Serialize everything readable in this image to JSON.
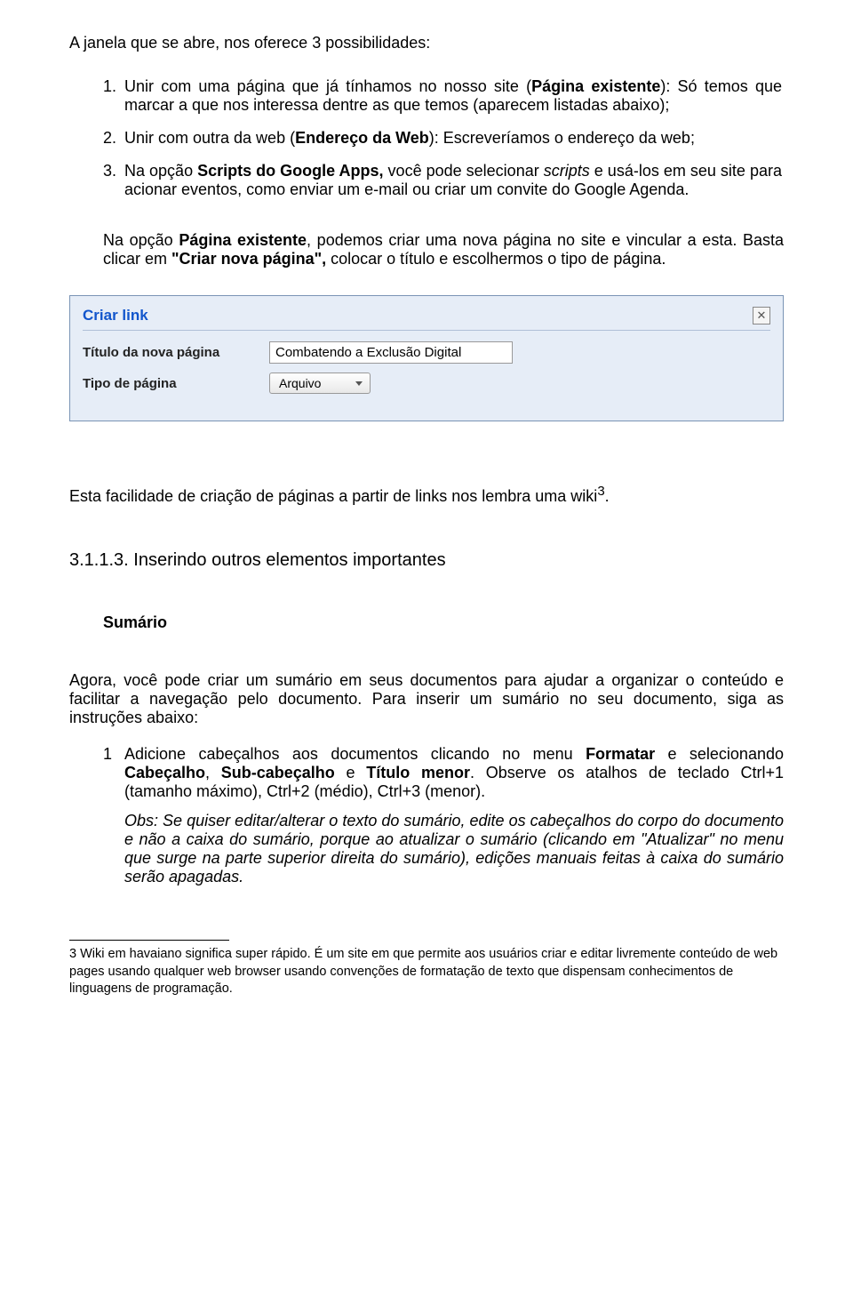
{
  "intro": "A janela que se abre, nos oferece 3 possibilidades:",
  "list": [
    {
      "num": "1.",
      "prefix": "Unir com uma página que já tínhamos no nosso site (",
      "bold1": "Página existente",
      "rest": "): Só temos que marcar a que nos interessa dentre as que temos (aparecem listadas abaixo);"
    },
    {
      "num": "2.",
      "prefix": "Unir com outra da web (",
      "bold1": "Endereço da Web",
      "rest": "): Escreveríamos o endereço da web;"
    },
    {
      "num": "3.",
      "prefix": "Na opção ",
      "bold1": "Scripts do Google Apps,",
      "rest2a": " você pode selecionar ",
      "italic1": "scripts",
      "rest2b": " e usá-los em seu site para acionar eventos, como enviar um e-mail ou criar um convite do Google Agenda."
    }
  ],
  "indented": {
    "p1a": "Na opção ",
    "p1b": "Página existente",
    "p1c": ", podemos criar uma nova página no site e vincular a esta. Basta clicar em ",
    "p1d": "\"Criar nova página\",",
    "p1e": " colocar o título e escolhermos o tipo de página."
  },
  "dialog": {
    "title": "Criar link",
    "label_title": "Título da nova página",
    "label_type": "Tipo de página",
    "input_value": "Combatendo a Exclusão Digital",
    "select_value": "Arquivo"
  },
  "after_shot": {
    "text": "Esta facilidade de criação de páginas a partir de links nos lembra uma wiki",
    "sup": "3",
    "period": "."
  },
  "section_head": "3.1.1.3. Inserindo outros elementos importantes",
  "sub_head": "Sumário",
  "paragraph": "Agora, você pode criar um sumário em seus documentos para ajudar a organizar o conteúdo e facilitar a navegação pelo documento. Para inserir um sumário no seu documento, siga as instruções abaixo:",
  "list2_num": "1",
  "list2_a": "Adicione cabeçalhos aos documentos clicando no menu ",
  "list2_b1": "Formatar",
  "list2_c": " e selecionando ",
  "list2_b2": "Cabeçalho",
  "list2_comma1": ", ",
  "list2_b3": "Sub-cabeçalho",
  "list2_and": " e ",
  "list2_b4": "Título menor",
  "list2_rest": ". Observe os atalhos de teclado Ctrl+1 (tamanho máximo), Ctrl+2 (médio), Ctrl+3 (menor).",
  "obs": "Obs: Se quiser editar/alterar o texto do sumário, edite os cabeçalhos do corpo do documento e não a caixa do sumário, porque ao atualizar o sumário (clicando em \"Atualizar\" no menu que surge na parte superior direita do sumário), edições manuais feitas à caixa do sumário serão apagadas.",
  "footnote": "3 Wiki em havaiano significa super rápido. É um site em que permite aos usuários criar e editar livremente conteúdo de web pages usando qualquer web browser usando convenções de formatação de texto que dispensam conhecimentos de linguagens de programação."
}
